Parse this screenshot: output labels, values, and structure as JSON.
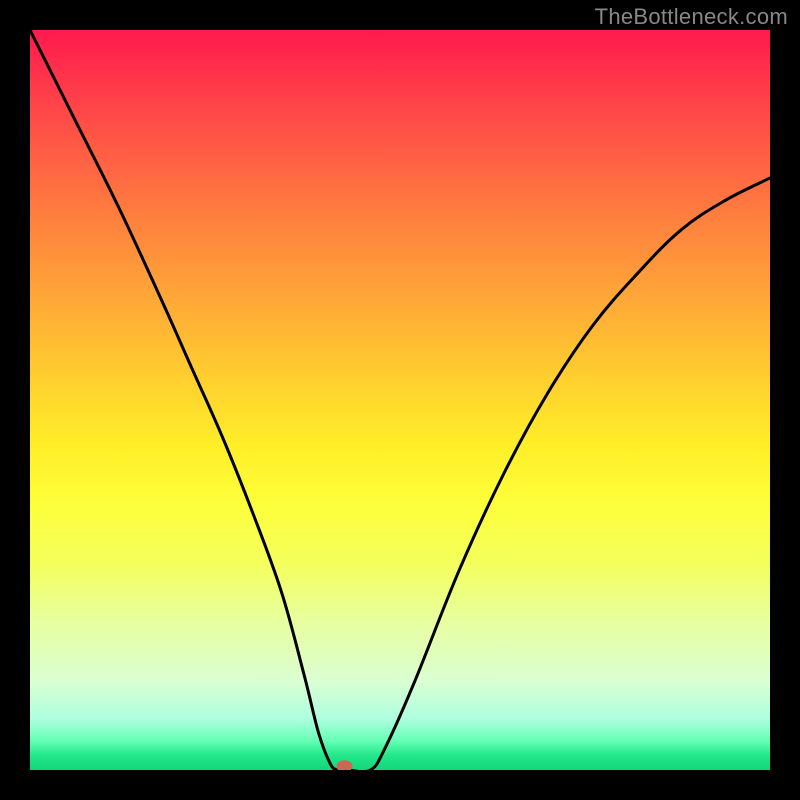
{
  "watermark": "TheBottleneck.com",
  "chart_data": {
    "type": "line",
    "title": "",
    "xlabel": "",
    "ylabel": "",
    "xlim": [
      0,
      100
    ],
    "ylim": [
      0,
      100
    ],
    "background_gradient": {
      "top_color": "#ff1a4d",
      "upper_mid_color": "#ffb534",
      "lower_mid_color": "#fdff3a",
      "bottom_color": "#14d67a"
    },
    "series": [
      {
        "name": "curve",
        "type": "line",
        "color": "#000000",
        "x": [
          0,
          6,
          12,
          18,
          22,
          26,
          30,
          34,
          37,
          39,
          40.5,
          41.5,
          43,
          46,
          48,
          52,
          58,
          64,
          70,
          76,
          82,
          88,
          94,
          100
        ],
        "y": [
          100,
          88,
          76,
          63,
          54,
          45,
          35,
          24,
          13,
          5,
          1,
          0,
          0,
          0,
          3,
          12,
          27,
          40,
          51,
          60,
          67,
          73,
          77,
          80
        ]
      },
      {
        "name": "marker",
        "type": "scatter",
        "color": "#cc6655",
        "x": [
          42.5
        ],
        "y": [
          0.5
        ]
      }
    ],
    "annotations": []
  }
}
